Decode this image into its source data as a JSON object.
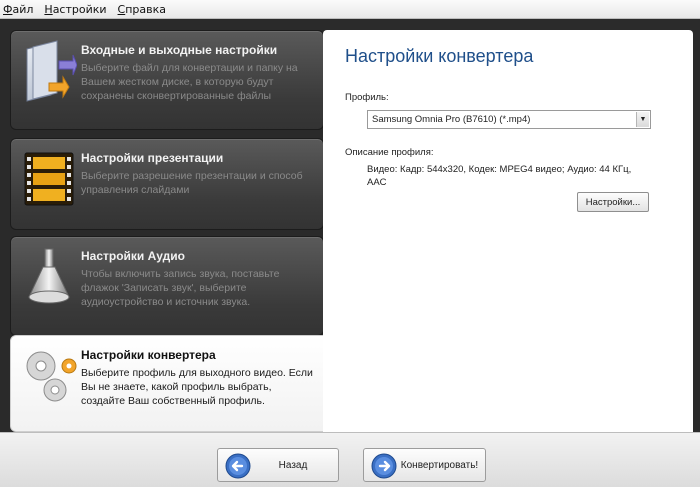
{
  "menu": {
    "items": [
      {
        "label": "Файл"
      },
      {
        "label": "Настройки"
      },
      {
        "label": "Справка"
      }
    ]
  },
  "steps": [
    {
      "title": "Входные и выходные настройки",
      "desc": "Выберите файл для конвертации и папку на Вашем жестком диске, в которую будут сохранены сконвертированные файлы",
      "icon": "folder-arrows-icon"
    },
    {
      "title": "Настройки презентации",
      "desc": "Выберите разрешение презентации и способ управления слайдами",
      "icon": "film-strip-icon"
    },
    {
      "title": "Настройки Аудио",
      "desc": "Чтобы включить запись звука, поставьте флажок 'Записать звук', выберите аудиоустройство и источник звука.",
      "icon": "loudspeaker-icon"
    },
    {
      "title": "Настройки конвертера",
      "desc": "Выберите профиль для выходного видео. Если Вы не знаете, какой профиль выбрать, создайте Ваш собственный профиль.",
      "icon": "gears-icon"
    }
  ],
  "panel": {
    "title": "Настройки конвертера",
    "profile_label": "Профиль:",
    "profile_value": "Samsung Omnia Pro (B7610) (*.mp4)",
    "profile_desc_label": "Описание профиля:",
    "profile_desc": "Видео: Кадр: 544x320, Кодек: MPEG4 видео;  Аудио: 44 КГц, AAC",
    "settings_button": "Настройки..."
  },
  "footer": {
    "back_label": "Назад",
    "convert_label": "Конвертировать!"
  }
}
